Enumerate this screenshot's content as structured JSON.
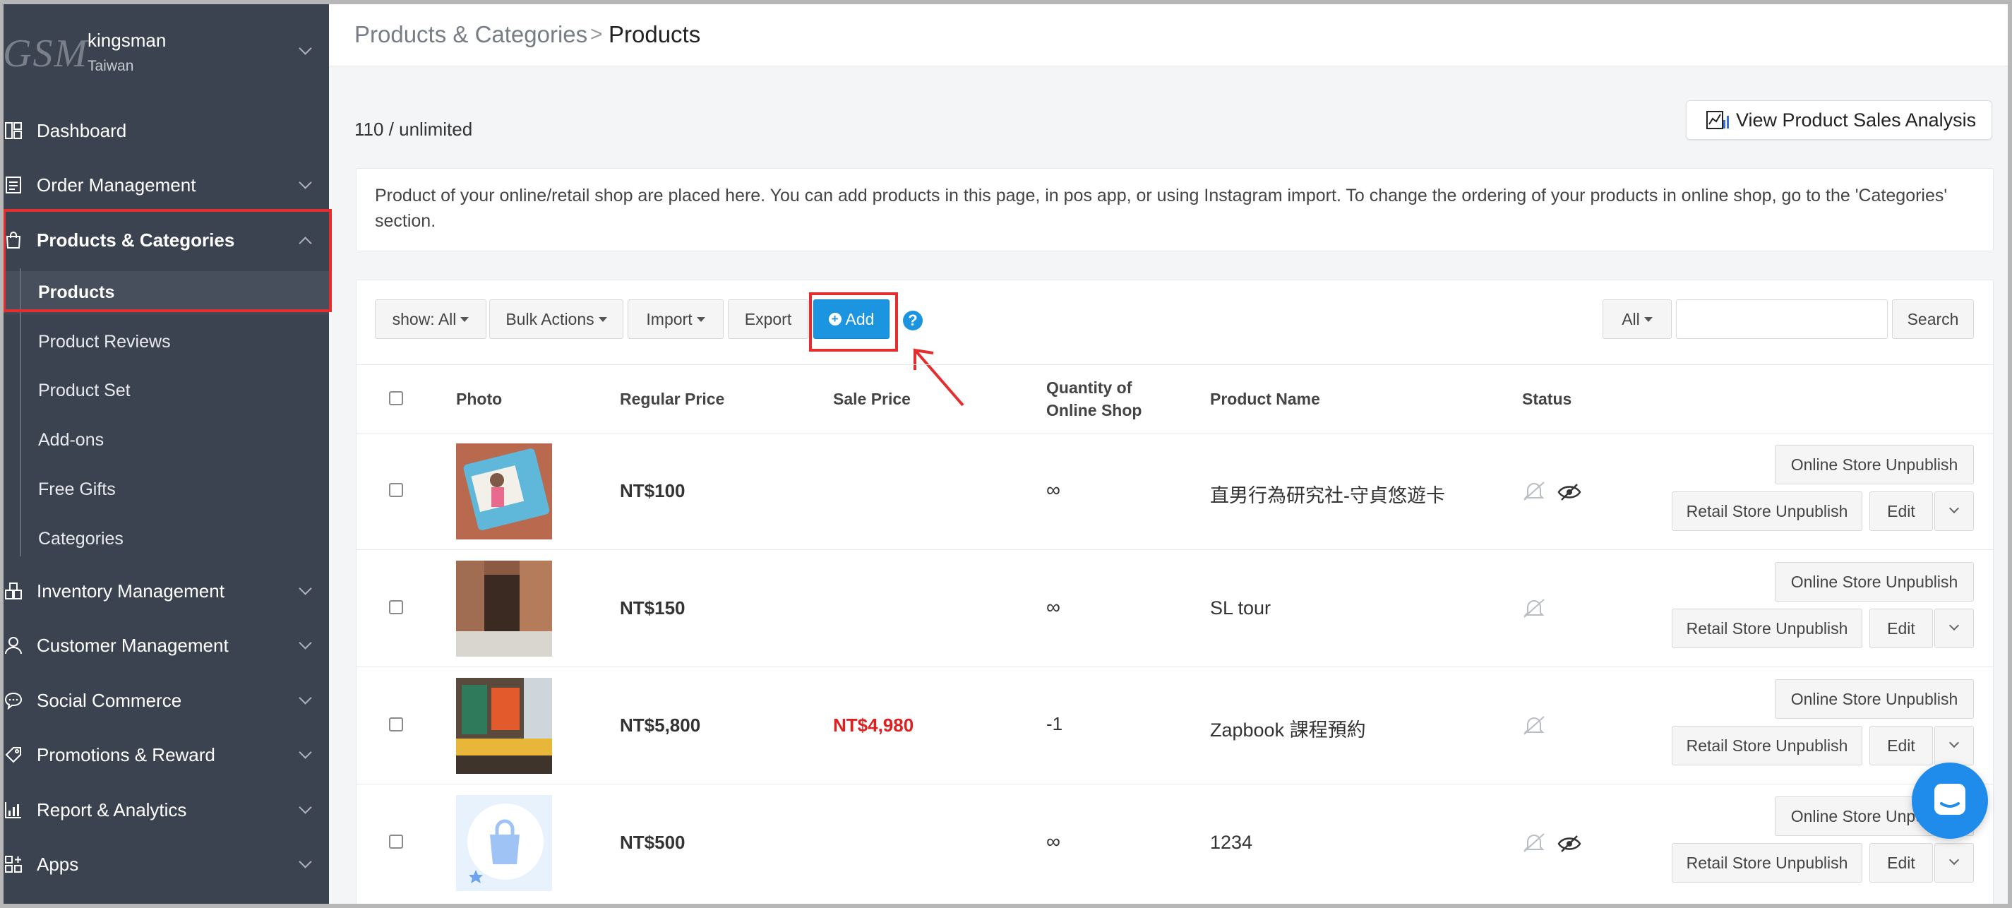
{
  "sidebar": {
    "logo": "GSM",
    "shop_name": "kingsman",
    "shop_country": "Taiwan",
    "items": [
      {
        "label": "Dashboard"
      },
      {
        "label": "Order Management"
      },
      {
        "label": "Products & Categories"
      },
      {
        "label": "Inventory Management"
      },
      {
        "label": "Customer Management"
      },
      {
        "label": "Social Commerce"
      },
      {
        "label": "Promotions & Reward"
      },
      {
        "label": "Report & Analytics"
      },
      {
        "label": "Apps"
      }
    ],
    "sub_items": [
      "Products",
      "Product Reviews",
      "Product Set",
      "Add-ons",
      "Free Gifts",
      "Categories"
    ]
  },
  "header": {
    "breadcrumb_parent": "Products & Categories",
    "breadcrumb_sep": ">",
    "breadcrumb_current": "Products"
  },
  "quota": "110 / unlimited",
  "analysis_button": "View Product Sales Analysis",
  "info_text": "Product of your online/retail shop are placed here. You can add products in this page, in pos app, or using Instagram import. To change the ordering of your products in online shop, go to the 'Categories' section.",
  "toolbar": {
    "show": "show: All",
    "bulk": "Bulk Actions",
    "import": "Import",
    "export": "Export",
    "add": "Add",
    "help": "?",
    "filter": "All",
    "search_value": "",
    "search_button": "Search"
  },
  "table": {
    "headers": {
      "photo": "Photo",
      "regular_price": "Regular Price",
      "sale_price": "Sale Price",
      "qty_line1": "Quantity of",
      "qty_line2": "Online Shop",
      "product_name": "Product Name",
      "status": "Status"
    },
    "rows": [
      {
        "regular_price": "NT$100",
        "sale_price": "",
        "qty": "∞",
        "name": "直男行為研究社-守貞悠遊卡",
        "hidden_icon": true
      },
      {
        "regular_price": "NT$150",
        "sale_price": "",
        "qty": "∞",
        "name": "SL tour",
        "hidden_icon": false
      },
      {
        "regular_price": "NT$5,800",
        "sale_price": "NT$4,980",
        "qty": "-1",
        "name": "Zapbook 課程預約",
        "hidden_icon": false
      },
      {
        "regular_price": "NT$500",
        "sale_price": "",
        "qty": "∞",
        "name": "1234",
        "hidden_icon": true
      }
    ],
    "actions": {
      "online_unpublish": "Online Store Unpublish",
      "retail_unpublish": "Retail Store Unpublish",
      "edit": "Edit"
    }
  },
  "colors": {
    "sidebar_bg": "#3b4350",
    "primary": "#1b95e0",
    "highlight": "#e52d2d",
    "sale_red": "#e02020"
  }
}
